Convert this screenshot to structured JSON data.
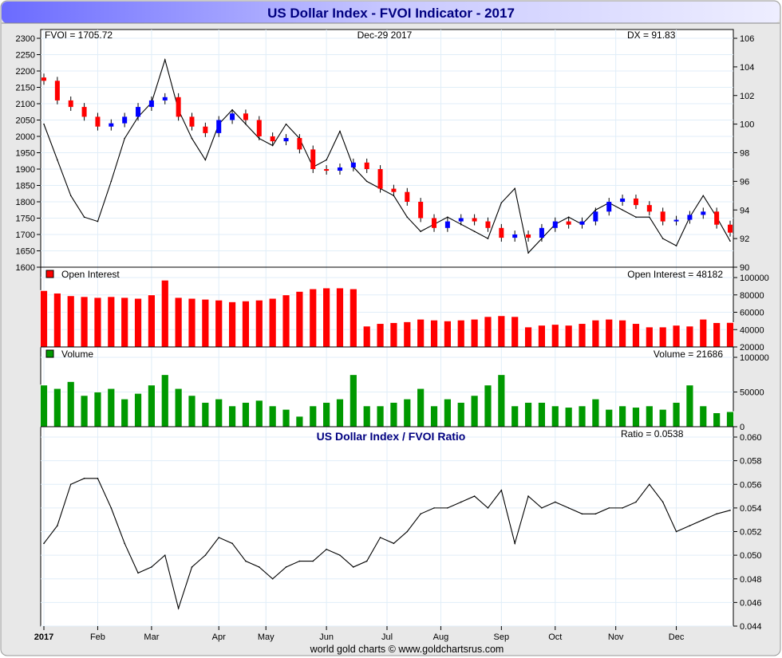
{
  "chart_data": {
    "type": "line",
    "title": "US Dollar Index - FVOI Indicator - 2017",
    "footer": "world gold charts © www.goldchartsrus.com",
    "date_label": "Dec-29  2017",
    "x_ticks": [
      "2017",
      "Feb",
      "Mar",
      "Apr",
      "May",
      "Jun",
      "Jul",
      "Aug",
      "Sep",
      "Oct",
      "Nov",
      "Dec"
    ],
    "x_tick_week_index": [
      0,
      4,
      8,
      13,
      16.5,
      21,
      25.5,
      29.5,
      34,
      38,
      42.5,
      47
    ],
    "price_panel": {
      "fvoi_label": "FVOI = 1705.72",
      "dx_label": "DX = 91.83",
      "left_axis": {
        "range": [
          1600,
          2300
        ],
        "ticks": [
          "2300",
          "2250",
          "2200",
          "2150",
          "2100",
          "2050",
          "2000",
          "1950",
          "1900",
          "1850",
          "1800",
          "1750",
          "1700",
          "1650",
          "1600"
        ]
      },
      "right_axis": {
        "range": [
          90,
          106
        ],
        "ticks": [
          "106",
          "104",
          "102",
          "100",
          "98",
          "96",
          "94",
          "92",
          "90"
        ]
      },
      "series": [
        {
          "name": "FVOI",
          "style": "candles",
          "values": [
            2170,
            2110,
            2090,
            2060,
            2030,
            2040,
            2060,
            2090,
            2110,
            2120,
            2060,
            2030,
            2010,
            2050,
            2070,
            2050,
            2000,
            1985,
            1995,
            1960,
            1900,
            1895,
            1905,
            1920,
            1900,
            1840,
            1830,
            1800,
            1750,
            1720,
            1740,
            1750,
            1740,
            1720,
            1690,
            1700,
            1690,
            1720,
            1740,
            1730,
            1740,
            1770,
            1800,
            1810,
            1790,
            1770,
            1740,
            1745,
            1760,
            1770,
            1730,
            1705.72
          ]
        },
        {
          "name": "DX",
          "style": "line",
          "values": [
            100,
            97.5,
            95,
            93.5,
            93.2,
            96,
            99,
            100.5,
            101.5,
            104.5,
            101,
            99,
            97.5,
            100,
            101,
            100,
            99,
            98.5,
            100,
            99,
            97,
            97.5,
            99.5,
            97,
            96,
            95.5,
            95,
            93.5,
            92.5,
            93,
            93.5,
            93,
            92.5,
            92,
            94.5,
            95.5,
            91,
            92,
            93,
            93.5,
            93,
            94,
            94.5,
            94,
            93.5,
            93.5,
            92,
            91.5,
            93.5,
            95,
            93.5,
            91.83
          ]
        }
      ],
      "up_color": "#0000ff",
      "down_color": "#ff0000"
    },
    "oi_panel": {
      "legend": "Open Interest",
      "label": "Open Interest = 48182",
      "color": "#ff0000",
      "axis": {
        "range": [
          20000,
          100000
        ],
        "ticks": [
          "100000",
          "80000",
          "60000",
          "40000",
          "20000"
        ]
      },
      "values": [
        85000,
        82000,
        79000,
        78000,
        77000,
        78000,
        77000,
        76000,
        80000,
        97000,
        77000,
        76000,
        75000,
        74000,
        72000,
        73000,
        74000,
        76000,
        80000,
        84000,
        87000,
        88000,
        88000,
        87000,
        44000,
        47000,
        48000,
        49000,
        52000,
        51000,
        50000,
        51000,
        52000,
        55000,
        56000,
        55000,
        43000,
        45000,
        46000,
        45000,
        47000,
        51000,
        52000,
        51000,
        47000,
        43000,
        43000,
        45000,
        44000,
        52000,
        48000,
        48182
      ]
    },
    "volume_panel": {
      "legend": "Volume",
      "label": "Volume = 21686",
      "color": "#009900",
      "axis": {
        "range": [
          0,
          100000
        ],
        "ticks": [
          "100000",
          "50000",
          "0"
        ]
      },
      "values": [
        60000,
        55000,
        65000,
        45000,
        50000,
        55000,
        40000,
        48000,
        60000,
        75000,
        55000,
        45000,
        35000,
        40000,
        30000,
        35000,
        38000,
        30000,
        25000,
        15000,
        30000,
        35000,
        40000,
        75000,
        30000,
        30000,
        35000,
        40000,
        55000,
        30000,
        40000,
        35000,
        45000,
        60000,
        75000,
        30000,
        35000,
        35000,
        30000,
        28000,
        30000,
        40000,
        25000,
        30000,
        28000,
        30000,
        25000,
        35000,
        60000,
        30000,
        20000,
        21686
      ]
    },
    "ratio_panel": {
      "title": "US Dollar Index / FVOI Ratio",
      "label": "Ratio = 0.0538",
      "axis": {
        "range": [
          0.044,
          0.06
        ],
        "ticks": [
          "0.060",
          "0.058",
          "0.056",
          "0.054",
          "0.052",
          "0.050",
          "0.048",
          "0.046",
          "0.044"
        ]
      },
      "values": [
        0.051,
        0.0525,
        0.056,
        0.0565,
        0.0565,
        0.054,
        0.051,
        0.0485,
        0.049,
        0.05,
        0.0455,
        0.049,
        0.05,
        0.0515,
        0.051,
        0.0495,
        0.049,
        0.048,
        0.049,
        0.0495,
        0.0495,
        0.0505,
        0.05,
        0.049,
        0.0495,
        0.0515,
        0.051,
        0.052,
        0.0535,
        0.054,
        0.054,
        0.0545,
        0.055,
        0.054,
        0.0555,
        0.051,
        0.055,
        0.054,
        0.0545,
        0.054,
        0.0535,
        0.0535,
        0.054,
        0.054,
        0.0545,
        0.056,
        0.0545,
        0.052,
        0.0525,
        0.053,
        0.0535,
        0.0538
      ]
    },
    "colors": {
      "title_text": "#000080",
      "grid": "#e0eef8",
      "frame_bg": "#e6e6e6",
      "title_grad_left": "#6b6bff",
      "title_grad_right": "#e8e8ff"
    }
  }
}
